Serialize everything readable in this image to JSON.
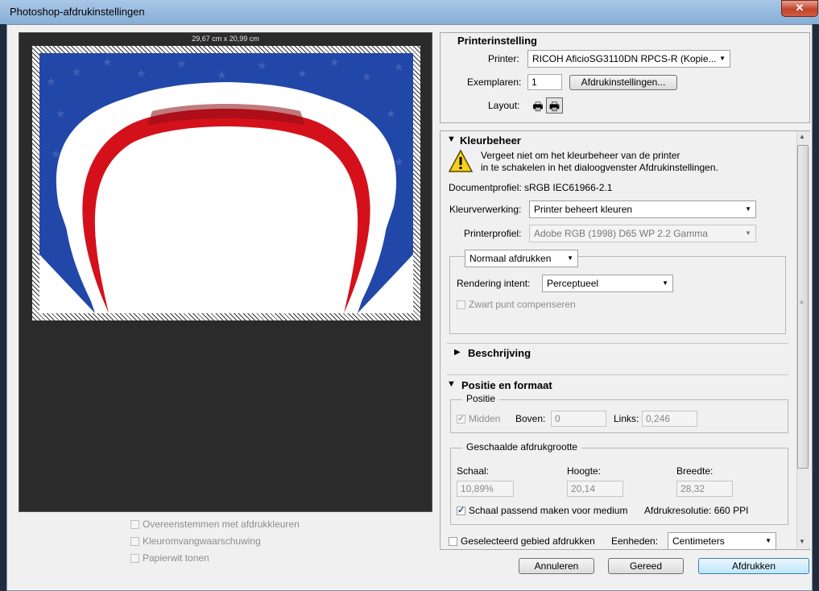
{
  "window": {
    "title": "Photoshop-afdrukinstellingen",
    "close": "✕"
  },
  "preview": {
    "paper_size": "29,67 cm x 20,99 cm"
  },
  "preview_options": {
    "match_colors": "Overeenstemmen met afdrukkleuren",
    "gamut_warning": "Kleuromvangwaarschuwing",
    "paper_white": "Papierwit tonen"
  },
  "printer_settings": {
    "heading": "Printerinstelling",
    "printer_label": "Printer:",
    "printer_value": "RICOH AficioSG3110DN RPCS-R (Kopie...",
    "copies_label": "Exemplaren:",
    "copies_value": "1",
    "print_settings_button": "Afdrukinstellingen...",
    "layout_label": "Layout:"
  },
  "color_management": {
    "heading": "Kleurbeheer",
    "warning_line1": "Vergeet niet om het kleurbeheer van de printer",
    "warning_line2": "in te schakelen in het dialoogvenster Afdrukinstellingen.",
    "document_profile": "Documentprofiel: sRGB IEC61966-2.1",
    "color_handling_label": "Kleurverwerking:",
    "color_handling_value": "Printer beheert kleuren",
    "printer_profile_label": "Printerprofiel:",
    "printer_profile_value": "Adobe RGB (1998) D65 WP 2.2 Gamma",
    "print_mode_value": "Normaal afdrukken",
    "rendering_intent_label": "Rendering intent:",
    "rendering_intent_value": "Perceptueel",
    "black_point": "Zwart punt compenseren"
  },
  "description": {
    "heading": "Beschrijving"
  },
  "position_size": {
    "heading": "Positie en formaat",
    "position_legend": "Positie",
    "center_label": "Midden",
    "top_label": "Boven:",
    "top_value": "0",
    "left_label": "Links:",
    "left_value": "0,246",
    "scaled_legend": "Geschaalde afdrukgrootte",
    "scale_label": "Schaal:",
    "scale_value": "10,89%",
    "height_label": "Hoogte:",
    "height_value": "20,14",
    "width_label": "Breedte:",
    "width_value": "28,32",
    "fit_media": "Schaal passend maken voor medium",
    "resolution": "Afdrukresolutie: 660 PPI",
    "print_selected": "Geselecteerd gebied afdrukken",
    "units_label": "Eenheden:",
    "units_value": "Centimeters"
  },
  "footer": {
    "cancel": "Annuleren",
    "done": "Gereed",
    "print": "Afdrukken"
  },
  "colors": {
    "accent": "#2f6fc6",
    "flag_blue": "#2147a8",
    "flag_red": "#d4111b"
  }
}
